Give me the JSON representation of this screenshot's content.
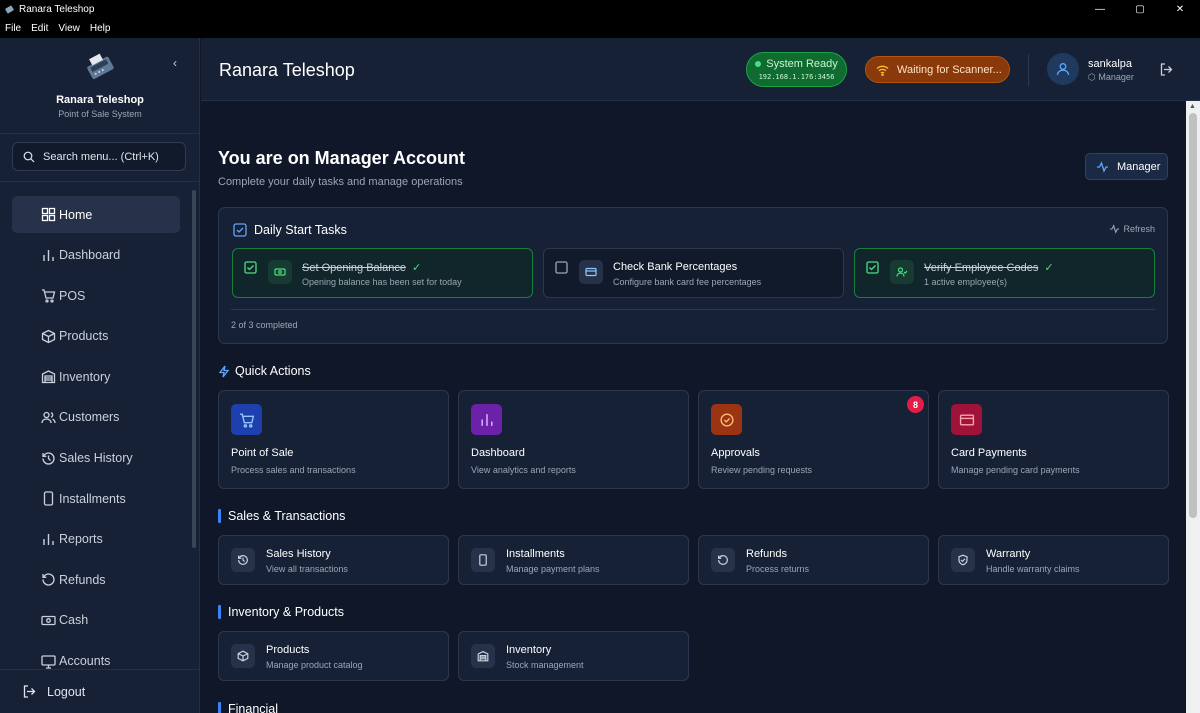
{
  "window": {
    "title": "Ranara Teleshop",
    "controls": [
      "minimize-icon",
      "maximize-icon",
      "close-icon"
    ]
  },
  "menubar": [
    "File",
    "Edit",
    "View",
    "Help"
  ],
  "sidebar": {
    "brand_name": "Ranara Teleshop",
    "brand_sub": "Point of Sale System",
    "search_placeholder": "Search menu... (Ctrl+K)",
    "items": [
      {
        "label": "Home",
        "icon": "grid-icon",
        "active": true
      },
      {
        "label": "Dashboard",
        "icon": "bar-chart-icon"
      },
      {
        "label": "POS",
        "icon": "cart-icon"
      },
      {
        "label": "Products",
        "icon": "box-icon"
      },
      {
        "label": "Inventory",
        "icon": "warehouse-icon"
      },
      {
        "label": "Customers",
        "icon": "users-icon"
      },
      {
        "label": "Sales History",
        "icon": "history-icon"
      },
      {
        "label": "Installments",
        "icon": "phone-icon"
      },
      {
        "label": "Reports",
        "icon": "bar-chart-icon"
      },
      {
        "label": "Refunds",
        "icon": "undo-icon"
      },
      {
        "label": "Cash",
        "icon": "banknote-icon"
      },
      {
        "label": "Accounts",
        "icon": "monitor-icon"
      }
    ],
    "logout_label": "Logout"
  },
  "header": {
    "title": "Ranara Teleshop",
    "system_status": "System Ready",
    "system_address": "192.168.1.176:3456",
    "scanner_status": "Waiting for Scanner...",
    "user_name": "sankalpa",
    "user_role": "Manager"
  },
  "main": {
    "welcome_title": "You are on Manager Account",
    "welcome_sub": "Complete your daily tasks and manage operations",
    "role_button": "Manager",
    "daily_tasks": {
      "title": "Daily Start Tasks",
      "refresh": "Refresh",
      "items": [
        {
          "title": "Set Opening Balance",
          "sub": "Opening balance has been set for today",
          "done": true,
          "check": "✓"
        },
        {
          "title": "Check Bank Percentages",
          "sub": "Configure bank card fee percentages",
          "done": false
        },
        {
          "title": "Verify Employee Codes",
          "sub": "1 active employee(s)",
          "done": true,
          "check": "✓"
        }
      ],
      "progress": "2 of 3 completed"
    },
    "quick_actions": {
      "title": "Quick Actions",
      "items": [
        {
          "title": "Point of Sale",
          "sub": "Process sales and transactions",
          "color": "#1e40af"
        },
        {
          "title": "Dashboard",
          "sub": "View analytics and reports",
          "color": "#6b21a8"
        },
        {
          "title": "Approvals",
          "sub": "Review pending requests",
          "color": "#9a3412",
          "badge": "8"
        },
        {
          "title": "Card Payments",
          "sub": "Manage pending card payments",
          "color": "#9f1239"
        }
      ]
    },
    "sales_section": {
      "title": "Sales & Transactions",
      "items": [
        {
          "title": "Sales History",
          "sub": "View all transactions"
        },
        {
          "title": "Installments",
          "sub": "Manage payment plans"
        },
        {
          "title": "Refunds",
          "sub": "Process returns"
        },
        {
          "title": "Warranty",
          "sub": "Handle warranty claims"
        }
      ]
    },
    "inventory_section": {
      "title": "Inventory & Products",
      "items": [
        {
          "title": "Products",
          "sub": "Manage product catalog"
        },
        {
          "title": "Inventory",
          "sub": "Stock management"
        }
      ]
    },
    "financial_section": {
      "title": "Financial"
    }
  }
}
